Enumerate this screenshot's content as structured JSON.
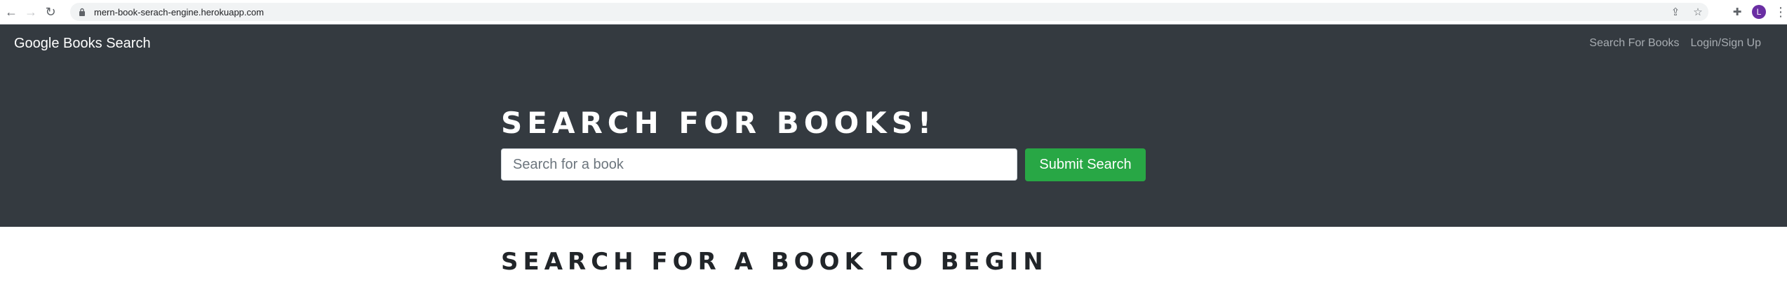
{
  "browser": {
    "url": "mern-book-serach-engine.herokuapp.com",
    "profile_initial": "L",
    "profile_color": "#6a2ea3"
  },
  "navbar": {
    "brand": "Google Books Search",
    "links": [
      "Search For Books",
      "Login/Sign Up"
    ]
  },
  "hero": {
    "title": "Search for Books!",
    "search_placeholder": "Search for a book",
    "search_value": "",
    "submit_label": "Submit Search"
  },
  "results": {
    "title": "Search for a book to begin"
  },
  "colors": {
    "header_bg": "#343a40",
    "submit_bg": "#28a745",
    "nav_link": "#a7acb1"
  }
}
